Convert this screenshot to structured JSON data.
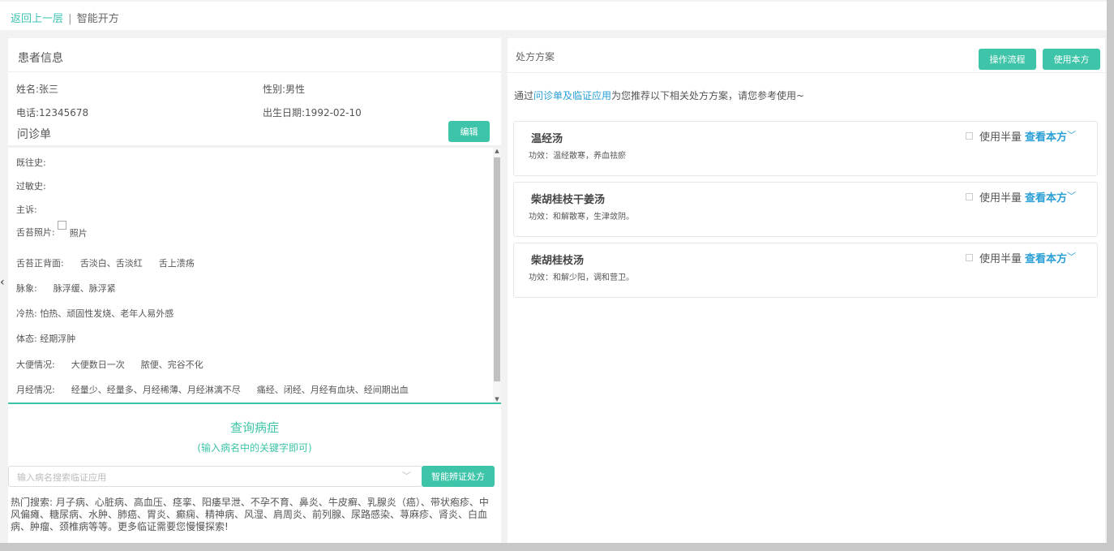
{
  "topbar": {
    "back_label": "返回上一层",
    "separator": "|",
    "title": "智能开方"
  },
  "patient": {
    "section_title": "患者信息",
    "name": "姓名:张三",
    "gender": "性别:男性",
    "phone": "电话:12345678",
    "birth": "出生日期:1992-02-10"
  },
  "inquiry": {
    "title": "问诊单",
    "edit_label": "编辑",
    "past_history": "既往史:",
    "allergy": "过敏史:",
    "chief": "主诉:",
    "tongue_photo_label": "舌苔照片:",
    "tongue_photo_alt": "照片",
    "tongue_label": "舌苔正背面:",
    "tongue_v1": "舌淡白、舌淡红",
    "tongue_v2": "舌上溃疡",
    "pulse_label": "脉象:",
    "pulse_v1": "脉浮缓、脉浮紧",
    "coldheat": "冷热: 怕热、顽固性发烧、老年人易外感",
    "body": "体态: 经期浮肿",
    "stool_label": "大便情况:",
    "stool_v1": "大便数日一次",
    "stool_v2": "脓便、完谷不化",
    "menses_label": "月经情况:",
    "menses_v1": "经量少、经量多、月经稀薄、月经淋漓不尽",
    "menses_v2": "痛经、闭经、月经有血块、经间期出血"
  },
  "query": {
    "title": "查询病症",
    "subtitle": "(输入病名中的关键字即可)",
    "placeholder": "输入病名搜索临证应用",
    "button_label": "智能辨证处方",
    "hot_search": "热门搜索: 月子病、心脏病、高血压、痉挛、阳痿早泄、不孕不育、鼻炎、牛皮癣、乳腺炎（癌）、带状疱疹、中风偏瘫、糖尿病、水肿、肺癌、胃炎、癫痫、精神病、风湿、肩周炎、前列腺、尿路感染、荨麻疹、肾炎、白血病、肿瘤、颈椎病等等。更多临证需要您慢慢探索!"
  },
  "plan": {
    "section_title": "处方方案",
    "flow_label": "操作流程",
    "use_label": "使用本方",
    "intro_prefix": "通过",
    "intro_link": "问诊单及临证应用",
    "intro_suffix": "为您推荐以下相关处方方案，请您参考使用~",
    "half_label": "使用半量",
    "view_label": "查看本方",
    "items": [
      {
        "name": "温经汤",
        "effect": "功效：温经散寒，养血祛瘀"
      },
      {
        "name": "柴胡桂枝干姜汤",
        "effect": "功效：和解散寒，生津敛阴。"
      },
      {
        "name": "柴胡桂枝汤",
        "effect": "功效：和解少阳，调和营卫。"
      }
    ]
  },
  "colors": {
    "accent": "#3ec4a8",
    "link": "#2a9fd6"
  }
}
